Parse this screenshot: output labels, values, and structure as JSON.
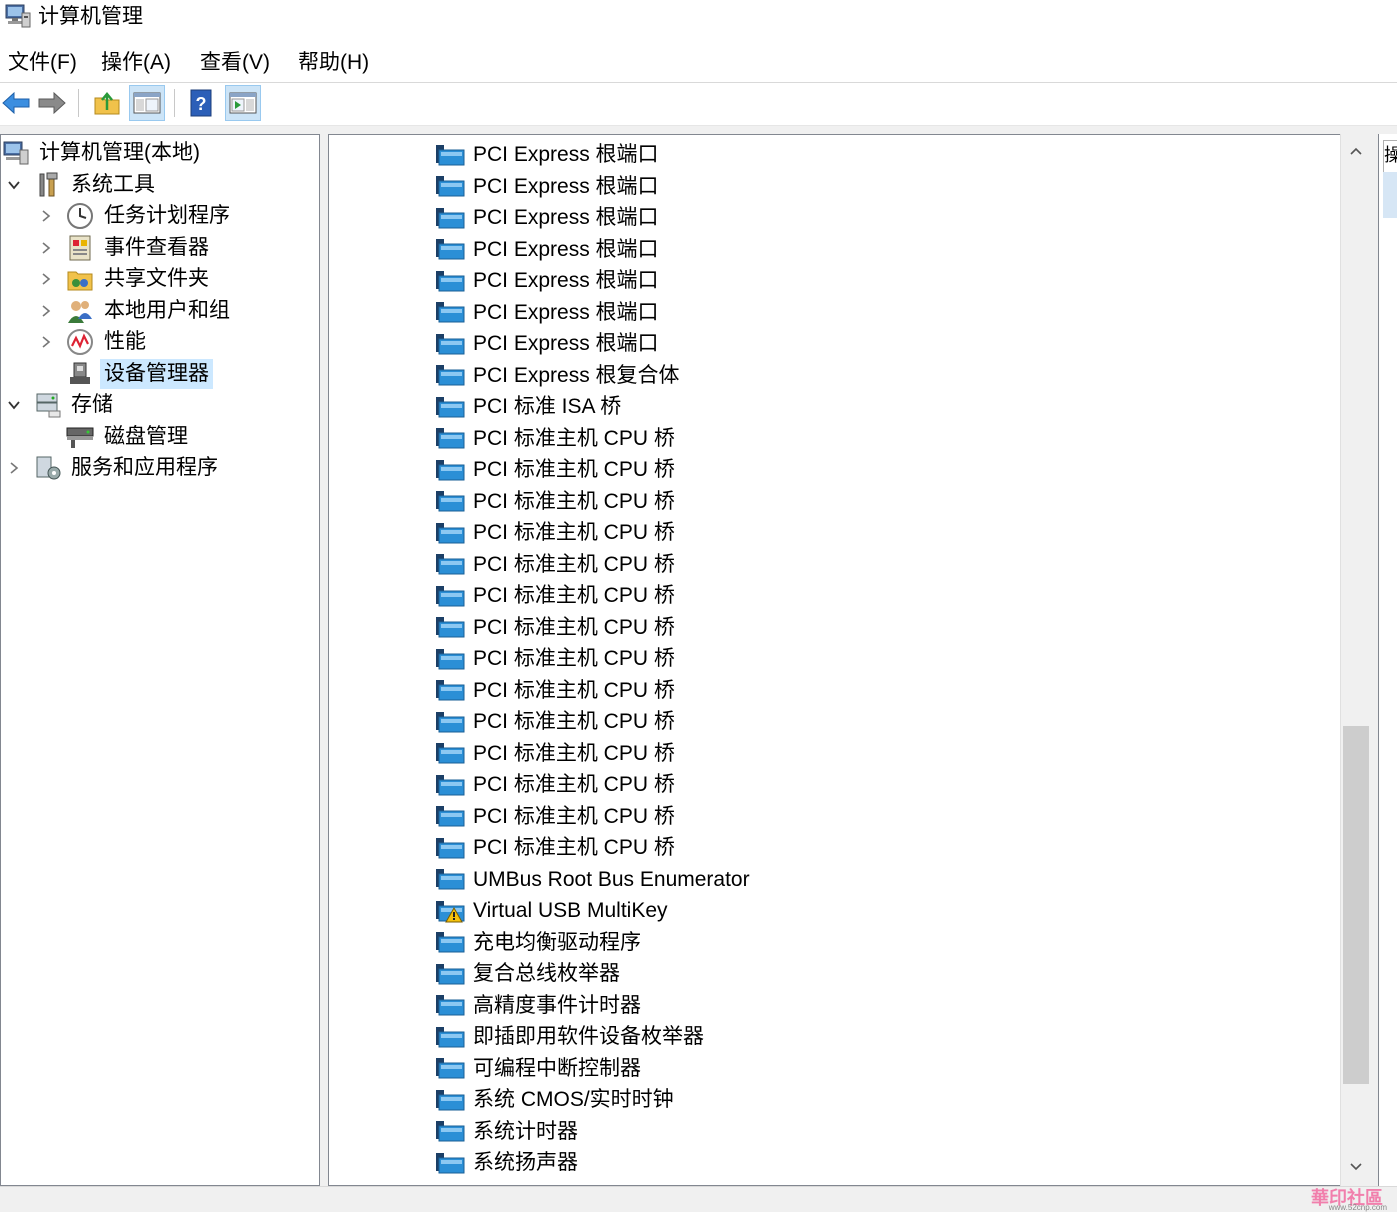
{
  "window": {
    "title": "计算机管理",
    "app_icon": "computer-management-icon"
  },
  "menu": [
    {
      "label": "文件(F)"
    },
    {
      "label": "操作(A)"
    },
    {
      "label": "查看(V)"
    },
    {
      "label": "帮助(H)"
    }
  ],
  "toolbar": [
    {
      "name": "back-button",
      "icon": "arrow-left-icon"
    },
    {
      "name": "forward-button",
      "icon": "arrow-right-icon"
    },
    {
      "name": "up-folder-button",
      "icon": "folder-up-icon"
    },
    {
      "name": "show-hide-tree-button",
      "icon": "console-tree-icon"
    },
    {
      "name": "help-button",
      "icon": "help-icon"
    },
    {
      "name": "show-hide-action-pane-button",
      "icon": "action-pane-icon"
    }
  ],
  "tree": [
    {
      "label": "计算机管理(本地)",
      "icon": "computer-management-icon",
      "expander": "none",
      "selected": false
    },
    {
      "label": "系统工具",
      "icon": "tools-icon",
      "expander": "expanded",
      "selected": false
    },
    {
      "label": "任务计划程序",
      "icon": "clock-icon",
      "expander": "collapsed",
      "selected": false
    },
    {
      "label": "事件查看器",
      "icon": "event-viewer-icon",
      "expander": "collapsed",
      "selected": false
    },
    {
      "label": "共享文件夹",
      "icon": "shared-folder-icon",
      "expander": "collapsed",
      "selected": false
    },
    {
      "label": "本地用户和组",
      "icon": "users-icon",
      "expander": "collapsed",
      "selected": false
    },
    {
      "label": "性能",
      "icon": "performance-icon",
      "expander": "collapsed",
      "selected": false
    },
    {
      "label": "设备管理器",
      "icon": "device-manager-icon",
      "expander": "none",
      "selected": true
    },
    {
      "label": "存储",
      "icon": "storage-icon",
      "expander": "expanded",
      "selected": false
    },
    {
      "label": "磁盘管理",
      "icon": "disk-management-icon",
      "expander": "none",
      "selected": false
    },
    {
      "label": "服务和应用程序",
      "icon": "services-icon",
      "expander": "collapsed",
      "selected": false
    }
  ],
  "devices": [
    {
      "label": "PCI Express 根端口",
      "warning": false
    },
    {
      "label": "PCI Express 根端口",
      "warning": false
    },
    {
      "label": "PCI Express 根端口",
      "warning": false
    },
    {
      "label": "PCI Express 根端口",
      "warning": false
    },
    {
      "label": "PCI Express 根端口",
      "warning": false
    },
    {
      "label": "PCI Express 根端口",
      "warning": false
    },
    {
      "label": "PCI Express 根端口",
      "warning": false
    },
    {
      "label": "PCI Express 根复合体",
      "warning": false
    },
    {
      "label": "PCI 标准 ISA 桥",
      "warning": false
    },
    {
      "label": "PCI 标准主机 CPU 桥",
      "warning": false
    },
    {
      "label": "PCI 标准主机 CPU 桥",
      "warning": false
    },
    {
      "label": "PCI 标准主机 CPU 桥",
      "warning": false
    },
    {
      "label": "PCI 标准主机 CPU 桥",
      "warning": false
    },
    {
      "label": "PCI 标准主机 CPU 桥",
      "warning": false
    },
    {
      "label": "PCI 标准主机 CPU 桥",
      "warning": false
    },
    {
      "label": "PCI 标准主机 CPU 桥",
      "warning": false
    },
    {
      "label": "PCI 标准主机 CPU 桥",
      "warning": false
    },
    {
      "label": "PCI 标准主机 CPU 桥",
      "warning": false
    },
    {
      "label": "PCI 标准主机 CPU 桥",
      "warning": false
    },
    {
      "label": "PCI 标准主机 CPU 桥",
      "warning": false
    },
    {
      "label": "PCI 标准主机 CPU 桥",
      "warning": false
    },
    {
      "label": "PCI 标准主机 CPU 桥",
      "warning": false
    },
    {
      "label": "PCI 标准主机 CPU 桥",
      "warning": false
    },
    {
      "label": "UMBus Root Bus Enumerator",
      "warning": false
    },
    {
      "label": "Virtual USB MultiKey",
      "warning": true
    },
    {
      "label": "充电均衡驱动程序",
      "warning": false
    },
    {
      "label": "复合总线枚举器",
      "warning": false
    },
    {
      "label": "高精度事件计时器",
      "warning": false
    },
    {
      "label": "即插即用软件设备枚举器",
      "warning": false
    },
    {
      "label": "可编程中断控制器",
      "warning": false
    },
    {
      "label": "系统 CMOS/实时时钟",
      "warning": false
    },
    {
      "label": "系统计时器",
      "warning": false
    },
    {
      "label": "系统扬声器",
      "warning": false
    }
  ],
  "action_pane": {
    "header": "操"
  },
  "watermark": {
    "text": "華印社區",
    "url": "www.52cnp.com"
  },
  "colors": {
    "selection": "#cce8ff",
    "device_icon": "#2b8fd6",
    "warning": "#f4c20d",
    "scroll_thumb": "#cdcdcd"
  }
}
